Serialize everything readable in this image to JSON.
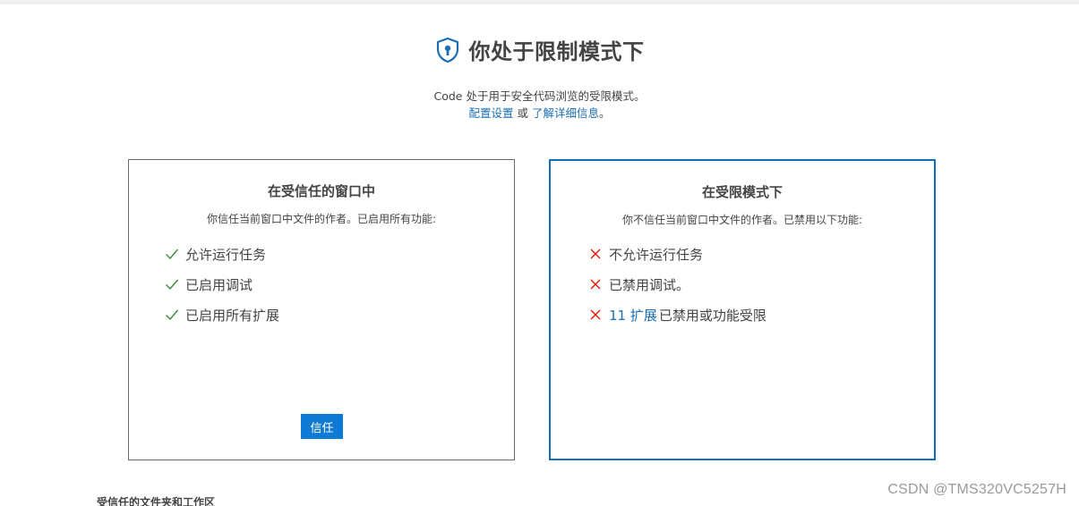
{
  "header": {
    "title": "你处于限制模式下",
    "icon": "shield-lock-icon",
    "subtitle": "Code 处于用于安全代码浏览的受限模式。",
    "configure_link": "配置设置",
    "or_text": " 或 ",
    "learn_more_link": "了解详细信息",
    "period": "。"
  },
  "trusted_card": {
    "title": "在受信任的窗口中",
    "description": "你信任当前窗口中文件的作者。已启用所有功能:",
    "features": [
      {
        "text": "允许运行任务",
        "icon": "check-icon"
      },
      {
        "text": "已启用调试",
        "icon": "check-icon"
      },
      {
        "text": "已启用所有扩展",
        "icon": "check-icon"
      }
    ],
    "button_label": "信任"
  },
  "restricted_card": {
    "title": "在受限模式下",
    "description": "你不信任当前窗口中文件的作者。已禁用以下功能:",
    "features": [
      {
        "text": "不允许运行任务",
        "icon": "x-icon"
      },
      {
        "text": "已禁用调试。",
        "icon": "x-icon"
      },
      {
        "count_link": "11 扩展",
        "text": "已禁用或功能受限",
        "icon": "x-icon"
      }
    ]
  },
  "trusted_folders": {
    "heading": "受信任的文件夹和工作区"
  },
  "watermark": "CSDN @TMS320VC5257H",
  "colors": {
    "accent": "#0e7ad3",
    "link": "#1a6fb5",
    "check": "#388a34",
    "cross": "#e51400",
    "restricted_border": "#0e6fb8"
  }
}
